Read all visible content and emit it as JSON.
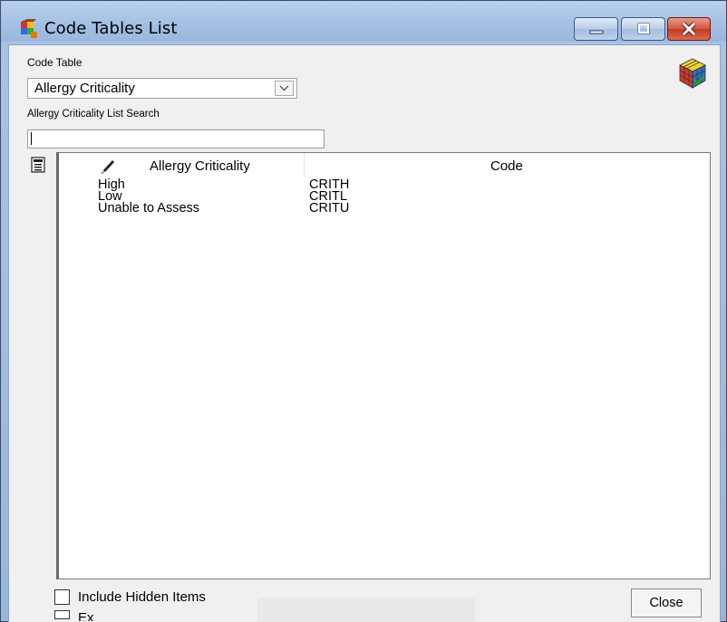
{
  "window": {
    "title": "Code Tables List"
  },
  "form": {
    "code_table_label": "Code Table",
    "code_table_value": "Allergy Criticality",
    "search_label": "Allergy Criticality List Search",
    "search_value": ""
  },
  "list": {
    "columns": [
      "Allergy Criticality",
      "Code"
    ],
    "rows": [
      {
        "name": "High",
        "code": "CRITH"
      },
      {
        "name": "Low",
        "code": "CRITL"
      },
      {
        "name": "Unable to Assess",
        "code": "CRITU"
      }
    ]
  },
  "footer": {
    "include_hidden_label": "Include Hidden Items",
    "second_option_label": "Ex",
    "close_label": "Close"
  },
  "colors": {
    "title_bar": "#a5c0e3",
    "close_button": "#c23c24"
  }
}
